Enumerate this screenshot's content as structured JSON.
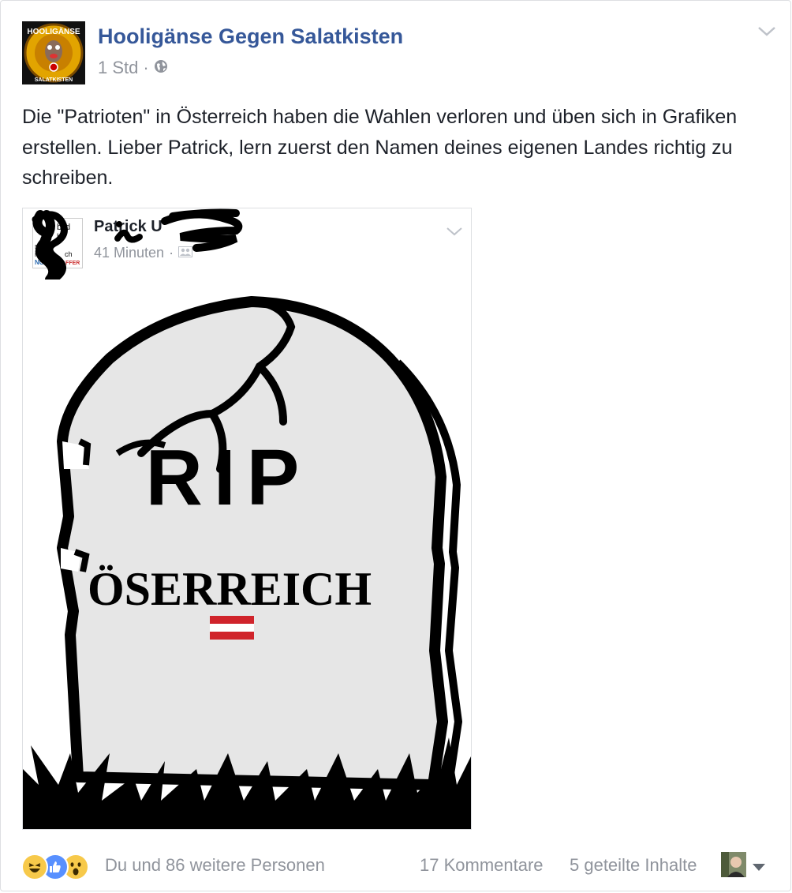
{
  "post": {
    "page_name": "Hooligänse Gegen Salatkisten",
    "time": "1 Std",
    "time_separator": "·",
    "privacy_icon": "globe-icon",
    "text": "Die \"Patrioten\" in Österreich haben die Wahlen verloren und üben sich in Grafiken erstellen. Lieber Patrick, lern zuerst den Namen deines eigenen Landes richtig zu schreiben.",
    "avatar_text_top": "HOOLIGÄNSE",
    "avatar_text_bottom": "SALATKISTEN"
  },
  "shared_post": {
    "author_name": "Patrick U",
    "time": "41 Minuten",
    "time_separator": "·",
    "audience_icon": "friends-icon",
    "avatar_lines": [
      "bild",
      "g",
      "ht",
      "son",
      "ihr",
      "ch",
      "NO",
      "AFFER"
    ],
    "image": {
      "title": "RIP",
      "country": "ÖSERREICH",
      "flag_colors": [
        "#d0242b",
        "#ffffff",
        "#d0242b"
      ],
      "stone_color": "#e6e6e6",
      "outline_color": "#000000"
    }
  },
  "footer": {
    "reactions": [
      "haha-icon",
      "like-icon",
      "wow-icon"
    ],
    "likers_text": "Du und 86 weitere Personen",
    "comments_text": "17 Kommentare",
    "shares_text": "5 geteilte Inhalte"
  },
  "colors": {
    "link_blue": "#365899",
    "meta_gray": "#90949c",
    "text": "#1d2129",
    "border": "#dddfe2",
    "like_blue": "#5890ff",
    "emoji_yellow": "#f7c94a"
  }
}
